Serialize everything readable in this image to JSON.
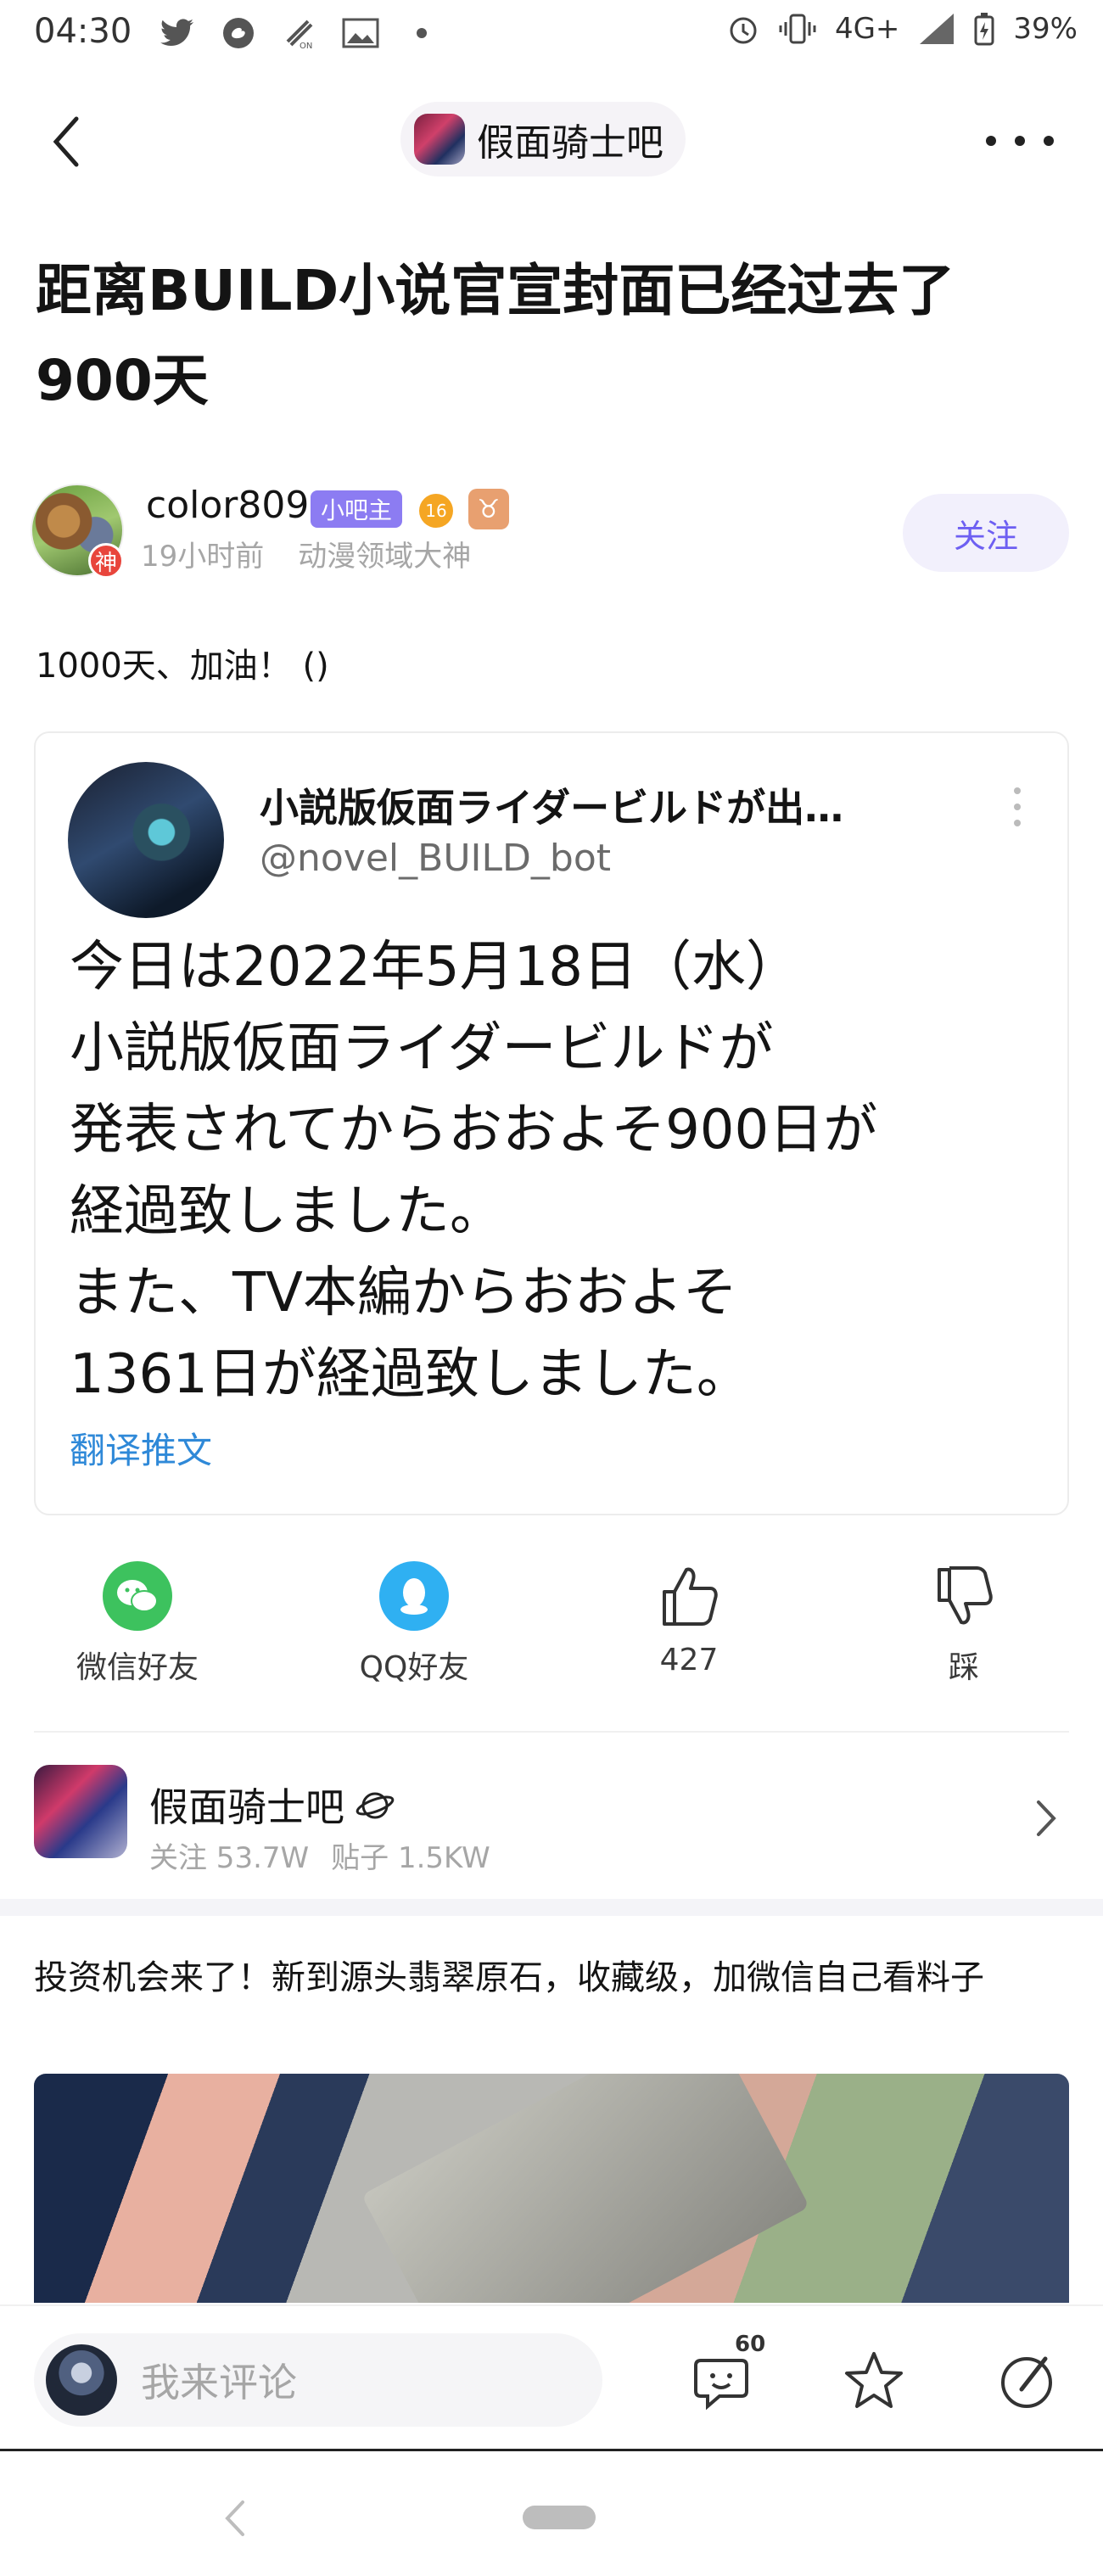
{
  "status_bar": {
    "time": "04:30",
    "network": "4G+",
    "battery": "39%",
    "left_icons": [
      "twitter-icon",
      "weibo-icon",
      "nfc-icon",
      "gallery-icon",
      "dot-icon"
    ],
    "right_icons": [
      "alarm-icon",
      "vibrate-icon",
      "signal-icon",
      "battery-icon"
    ]
  },
  "header": {
    "forum_name": "假面骑士吧"
  },
  "post": {
    "title": "距离BUILD小说官宣封面已经过去了900天",
    "author": {
      "name": "color809",
      "owner_tag": "小吧主",
      "level": "16",
      "sign_badge": "♉",
      "avatar_badge": "神",
      "time": "19小时前",
      "title": "动漫领域大神"
    },
    "follow_label": "关注",
    "body": "1000天、加油！ ()"
  },
  "tweet": {
    "name": "小説版仮面ライダービルドが出…",
    "handle": "@novel_BUILD_bot",
    "lines": [
      "今日は2022年5月18日（水）",
      "小説版仮面ライダービルドが",
      "発表されてからおおよそ900日が",
      "経過致しました。",
      "また、TV本編からおおよそ",
      "1361日が経過致しました。"
    ],
    "translate_label": "翻译推文"
  },
  "share": {
    "wechat": "微信好友",
    "qq": "QQ好友",
    "likes": "427",
    "dislike": "踩"
  },
  "forum_card": {
    "name": "假面骑士吧",
    "followers_label": "关注 53.7W",
    "posts_label": "贴子 1.5KW"
  },
  "ad_post": {
    "text": "投资机会来了！新到源头翡翠原石，收藏级，加微信自己看料子"
  },
  "bottom_bar": {
    "comment_placeholder": "我来评论",
    "emoji_count": "60"
  },
  "colors": {
    "accent": "#6d5ff2",
    "link": "#2f89d8",
    "wechat": "#3dc25e",
    "qq": "#2fb0f2"
  }
}
